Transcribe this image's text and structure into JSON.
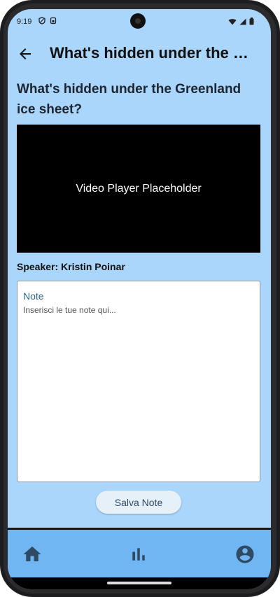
{
  "status_bar": {
    "time": "9:19"
  },
  "app_bar": {
    "title": "What's hidden under the Greenland ice sheet?"
  },
  "talk": {
    "title": "What's hidden under the Greenland ice sheet?",
    "video_placeholder": "Video Player Placeholder",
    "speaker": "Speaker: Kristin Poinar"
  },
  "notes": {
    "label": "Note",
    "placeholder": "Inserisci le tue note qui...",
    "value": ""
  },
  "save_button": {
    "label": "Salva Note"
  },
  "bottom_nav": {
    "items": [
      {
        "icon": "home-icon"
      },
      {
        "icon": "bar-chart-icon"
      },
      {
        "icon": "account-circle-icon"
      }
    ]
  },
  "colors": {
    "background": "#aad6fb",
    "bottom_nav": "#6fb6f2",
    "icon": "#2f4a62"
  }
}
